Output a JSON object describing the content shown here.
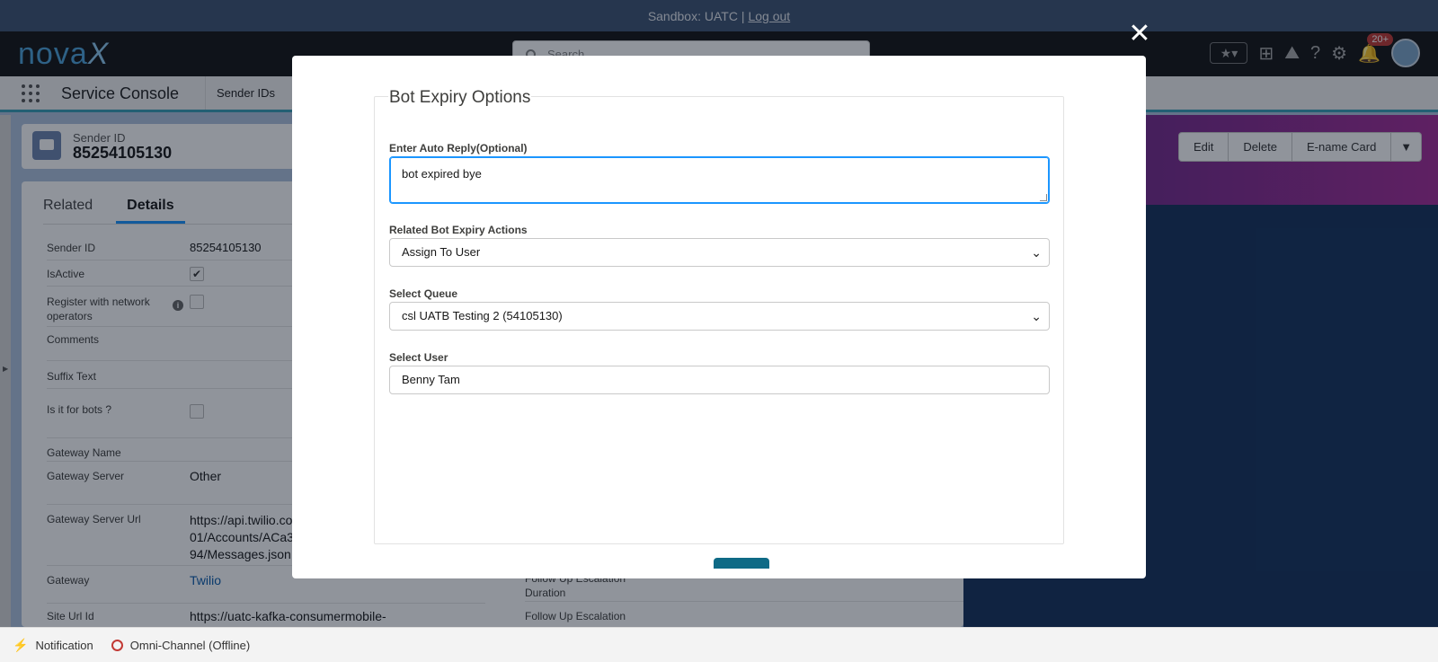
{
  "sandbox_bar": {
    "text": "Sandbox: UATC |",
    "logout_label": "Log out"
  },
  "header": {
    "logo_text": "nova",
    "logo_x": "X",
    "search_placeholder": "Search",
    "notification_count": "20+"
  },
  "app_nav": {
    "app_name": "Service Console",
    "tab_label": "Sender IDs"
  },
  "record": {
    "object_label": "Sender ID",
    "title": "85254105130",
    "actions": [
      "Edit",
      "Delete",
      "E-name Card"
    ]
  },
  "detail_tabs": {
    "related": "Related",
    "details": "Details"
  },
  "fields": {
    "sender_id": {
      "label": "Sender ID",
      "value": "85254105130"
    },
    "is_active": {
      "label": "IsActive",
      "checked": true
    },
    "register": {
      "label": "Register with network operators",
      "checked": false
    },
    "comments": {
      "label": "Comments"
    },
    "suffix_text": {
      "label": "Suffix Text"
    },
    "for_bots": {
      "label": "Is it for bots ?",
      "checked": false
    },
    "gateway_name": {
      "label": "Gateway Name"
    },
    "gateway_server": {
      "label": "Gateway Server",
      "value": "Other"
    },
    "gateway_server_url": {
      "label": "Gateway Server Url",
      "line1": "https://api.twilio.co",
      "line2": "01/Accounts/ACa3",
      "line3": "94/Messages.json"
    },
    "gateway": {
      "label": "Gateway",
      "value": "Twilio"
    },
    "site_url_id": {
      "label": "Site Url Id",
      "value": "https://uatc-kafka-consumermobile-"
    },
    "follow_up_duration": {
      "label1": "Follow Up Escalation",
      "label2": "Duration"
    },
    "follow_up_status": {
      "label1": "Follow Up Escalation"
    }
  },
  "modal": {
    "legend": "Bot Expiry Options",
    "auto_reply": {
      "label": "Enter Auto Reply(Optional)",
      "value": "bot expired bye"
    },
    "expiry_actions": {
      "label": "Related Bot Expiry Actions",
      "value": "Assign To User"
    },
    "queue": {
      "label": "Select Queue",
      "value": "csl UATB Testing 2 (54105130)"
    },
    "user": {
      "label": "Select User",
      "value": "Benny Tam"
    }
  },
  "utility_bar": {
    "notification": "Notification",
    "omni_channel": "Omni-Channel (Offline)"
  },
  "colors": {
    "accent": "#1b96ff",
    "header_dark": "#141414",
    "sandbox": "#3f5574"
  }
}
